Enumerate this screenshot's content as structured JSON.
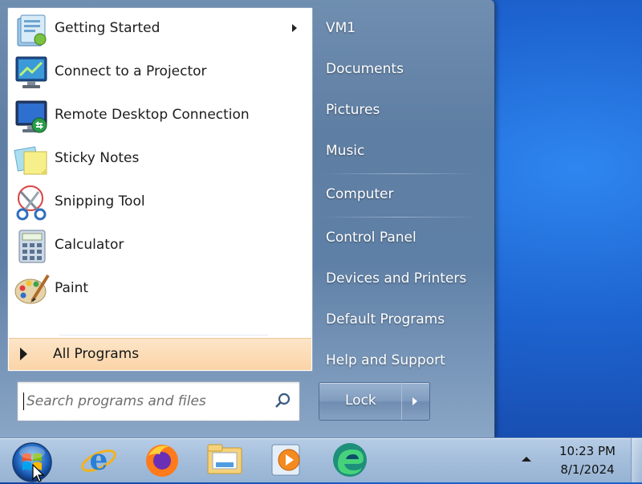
{
  "start_menu": {
    "pinned_programs": [
      {
        "label": "Getting Started",
        "icon": "getting-started-icon",
        "has_submenu": true
      },
      {
        "label": "Connect to a Projector",
        "icon": "projector-icon"
      },
      {
        "label": "Remote Desktop Connection",
        "icon": "remote-desktop-icon"
      },
      {
        "label": "Sticky Notes",
        "icon": "sticky-notes-icon"
      },
      {
        "label": "Snipping Tool",
        "icon": "snipping-tool-icon"
      },
      {
        "label": "Calculator",
        "icon": "calculator-icon"
      },
      {
        "label": "Paint",
        "icon": "paint-icon"
      }
    ],
    "all_programs_label": "All Programs",
    "search_placeholder": "Search programs and files",
    "right_items": [
      {
        "label": "VM1"
      },
      {
        "label": "Documents"
      },
      {
        "label": "Pictures"
      },
      {
        "label": "Music"
      },
      {
        "label": "Computer"
      },
      {
        "label": "Control Panel"
      },
      {
        "label": "Devices and Printers"
      },
      {
        "label": "Default Programs"
      },
      {
        "label": "Help and Support"
      }
    ],
    "power_button_label": "Lock"
  },
  "taskbar": {
    "pinned": [
      {
        "icon": "internet-explorer-icon"
      },
      {
        "icon": "firefox-icon"
      },
      {
        "icon": "file-explorer-icon"
      },
      {
        "icon": "media-player-icon"
      },
      {
        "icon": "edge-icon"
      }
    ],
    "clock": {
      "time": "10:23 PM",
      "date": "8/1/2024"
    }
  },
  "colors": {
    "desktop": "#1d63cf",
    "menu_right_pane": "#5f7ea3",
    "all_programs_highlight": "#fbd4a7"
  }
}
